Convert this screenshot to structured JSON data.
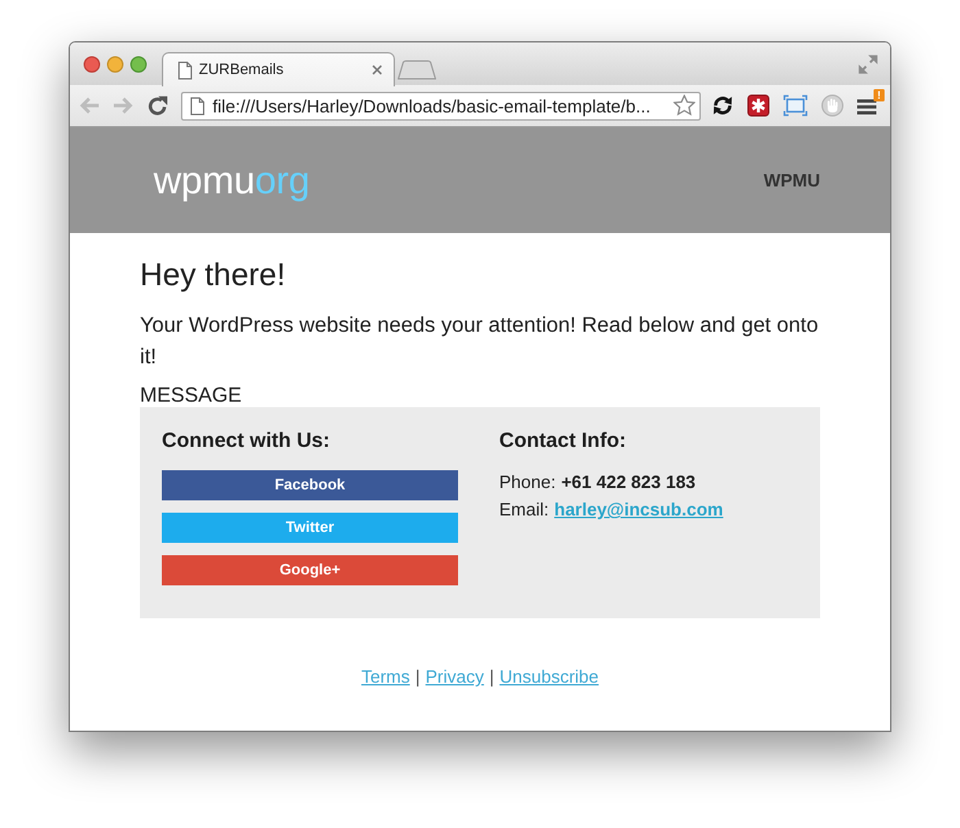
{
  "browser": {
    "tabs": [
      {
        "title": "ZURBemails",
        "selected": true
      }
    ],
    "nav_buttons": [
      {
        "kind": "back",
        "disabled": true
      },
      {
        "kind": "forward",
        "disabled": true
      },
      {
        "kind": "reload",
        "disabled": false
      }
    ],
    "address": "file:///Users/Harley/Downloads/basic-email-template/b...",
    "menu_badge": "!"
  },
  "email": {
    "header": {
      "logo": {
        "main": "wpmu",
        "accent": "org"
      },
      "nav_link": "WPMU"
    },
    "greeting": "Hey there!",
    "intro": "Your WordPress website needs your attention! Read below and get onto it!",
    "section_label": "MESSAGE",
    "panel": {
      "connect": {
        "heading": "Connect with Us:",
        "buttons": [
          {
            "label": "Facebook",
            "color": "#3b5998"
          },
          {
            "label": "Twitter",
            "color": "#1daced"
          },
          {
            "label": "Google+",
            "color": "#db4a39"
          }
        ]
      },
      "contact": {
        "heading": "Contact Info:",
        "lines": [
          {
            "kind": "bold",
            "label": "Phone:",
            "value": "+61 422 823 183"
          },
          {
            "kind": "link",
            "label": "Email:",
            "value": "harley@incsub.com"
          }
        ]
      }
    },
    "footer": [
      {
        "kind": "link",
        "text": "Terms"
      },
      {
        "kind": "separator",
        "text": "|"
      },
      {
        "kind": "link",
        "text": "Privacy"
      },
      {
        "kind": "separator",
        "text": "|"
      },
      {
        "kind": "link",
        "text": "Unsubscribe"
      }
    ]
  }
}
